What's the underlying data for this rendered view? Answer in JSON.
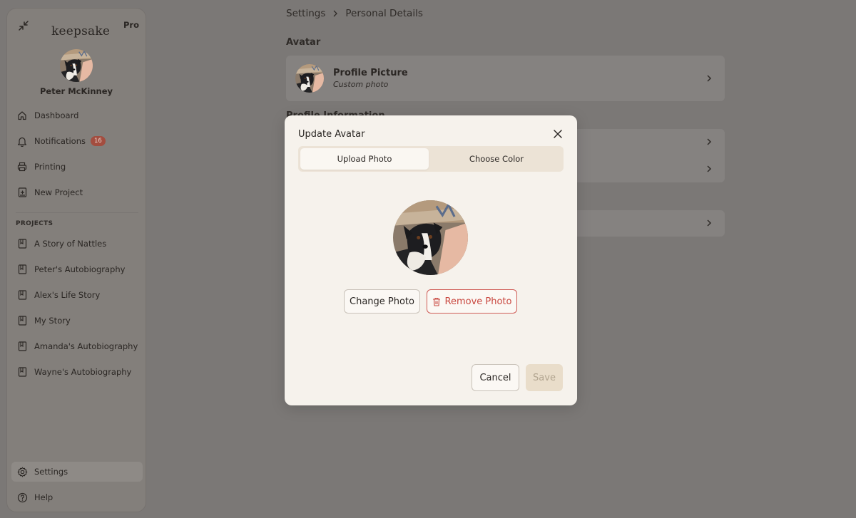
{
  "sidebar": {
    "brand": "keepsake",
    "plan_badge": "Pro",
    "user_name": "Peter McKinney",
    "nav": [
      {
        "label": "Dashboard",
        "icon": "home-icon"
      },
      {
        "label": "Notifications",
        "icon": "bell-icon",
        "badge": "16"
      },
      {
        "label": "Printing",
        "icon": "printer-icon"
      },
      {
        "label": "New Project",
        "icon": "new-project-icon"
      }
    ],
    "projects_heading": "PROJECTS",
    "projects": [
      "A Story of Nattles",
      "Peter's Autobiography",
      "Alex's Life Story",
      "My Story",
      "Amanda's Autobiography",
      "Wayne's Autobiography"
    ],
    "bottom": [
      {
        "label": "Settings",
        "icon": "gear-icon",
        "active": true
      },
      {
        "label": "Help",
        "icon": "help-icon"
      }
    ]
  },
  "breadcrumb": {
    "root": "Settings",
    "current": "Personal Details"
  },
  "main": {
    "avatar_section_title": "Avatar",
    "profile_picture_title": "Profile Picture",
    "profile_picture_subtitle": "Custom photo",
    "profile_info_title": "Profile Information"
  },
  "modal": {
    "title": "Update Avatar",
    "tabs": [
      {
        "label": "Upload Photo",
        "selected": true
      },
      {
        "label": "Choose Color",
        "selected": false
      }
    ],
    "change_photo_label": "Change Photo",
    "remove_photo_label": "Remove Photo",
    "cancel_label": "Cancel",
    "save_label": "Save"
  },
  "colors": {
    "overlay": "#7b7876",
    "modal_bg": "#f6f2ec",
    "danger": "#c9473f",
    "badge": "#a34d3f",
    "save_disabled_bg": "#e9ddca"
  }
}
